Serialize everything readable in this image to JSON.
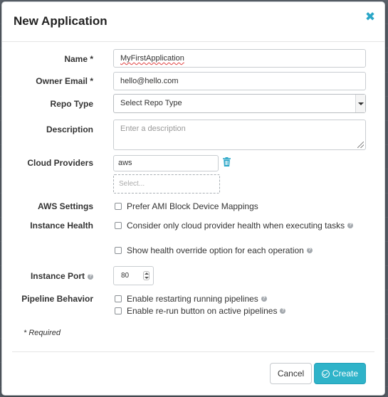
{
  "dialog": {
    "title": "New Application",
    "close_icon": "close-icon",
    "required_note": "* Required"
  },
  "fields": {
    "name": {
      "label": "Name *",
      "value": "MyFirstApplication"
    },
    "owner_email": {
      "label": "Owner Email *",
      "value": "hello@hello.com"
    },
    "repo_type": {
      "label": "Repo Type",
      "value": "Select Repo Type"
    },
    "description": {
      "label": "Description",
      "placeholder": "Enter a description"
    },
    "cloud_providers": {
      "label": "Cloud Providers",
      "selected": "aws",
      "placeholder": "Select..."
    },
    "aws_settings": {
      "label": "AWS Settings",
      "option": "Prefer AMI Block Device Mappings",
      "checked": false
    },
    "instance_health": {
      "label": "Instance Health",
      "option1": "Consider only cloud provider health when executing tasks",
      "option2": "Show health override option for each operation"
    },
    "instance_port": {
      "label": "Instance Port",
      "value": "80"
    },
    "pipeline_behavior": {
      "label": "Pipeline Behavior",
      "option1": "Enable restarting running pipelines",
      "option2": "Enable re-run button on active pipelines"
    }
  },
  "buttons": {
    "cancel": "Cancel",
    "create": "Create"
  },
  "colors": {
    "accent": "#2fb3c9",
    "trash": "#2aa6c7",
    "close": "#2aa6c7"
  }
}
